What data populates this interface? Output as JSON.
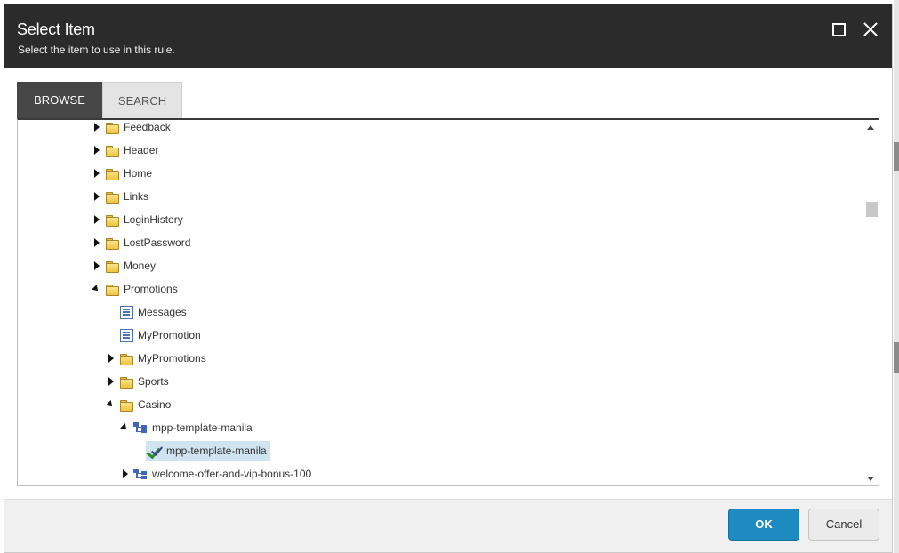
{
  "dialog": {
    "title": "Select Item",
    "subtitle": "Select the item to use in this rule."
  },
  "tabs": [
    {
      "label": "BROWSE",
      "active": true
    },
    {
      "label": "SEARCH",
      "active": false
    }
  ],
  "tree": [
    {
      "label": "Feedback",
      "icon": "folder-icon",
      "expander": "collapsed"
    },
    {
      "label": "Header",
      "icon": "folder-icon",
      "expander": "collapsed"
    },
    {
      "label": "Home",
      "icon": "folder-icon",
      "expander": "collapsed"
    },
    {
      "label": "Links",
      "icon": "folder-icon",
      "expander": "collapsed"
    },
    {
      "label": "LoginHistory",
      "icon": "folder-icon",
      "expander": "collapsed"
    },
    {
      "label": "LostPassword",
      "icon": "folder-icon",
      "expander": "collapsed"
    },
    {
      "label": "Money",
      "icon": "folder-icon",
      "expander": "collapsed"
    },
    {
      "label": "Promotions",
      "icon": "folder-icon",
      "expander": "expanded"
    },
    {
      "label": "Messages",
      "icon": "item-icon",
      "expander": "none"
    },
    {
      "label": "MyPromotion",
      "icon": "item-icon",
      "expander": "none"
    },
    {
      "label": "MyPromotions",
      "icon": "folder-icon",
      "expander": "collapsed"
    },
    {
      "label": "Sports",
      "icon": "folder-icon",
      "expander": "collapsed"
    },
    {
      "label": "Casino",
      "icon": "folder-icon",
      "expander": "expanded"
    },
    {
      "label": "mpp-template-manila",
      "icon": "template-icon",
      "expander": "expanded"
    },
    {
      "label": "mpp-template-manila",
      "icon": "check-icon",
      "expander": "none",
      "selected": true
    },
    {
      "label": "welcome-offer-and-vip-bonus-100",
      "icon": "template-icon",
      "expander": "collapsed"
    }
  ],
  "footer": {
    "ok_label": "OK",
    "cancel_label": "Cancel"
  },
  "colors": {
    "header_bg": "#2b2b2b",
    "primary_button": "#1d8bbf",
    "selection": "#cfe3f1"
  }
}
